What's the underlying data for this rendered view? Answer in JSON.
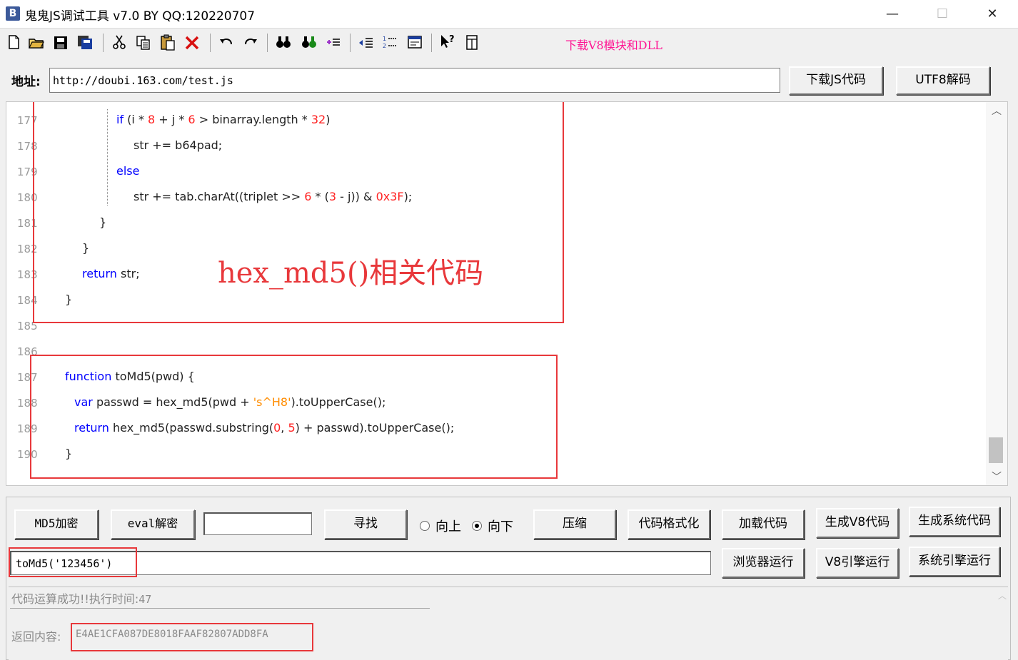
{
  "window": {
    "title": "鬼鬼JS调试工具 v7.0 BY QQ:120220707",
    "icon_letter": "B",
    "minimize": "—",
    "maximize": "☐",
    "close": "✕"
  },
  "toolbar": {
    "icons": [
      "new-file-icon",
      "open-folder-icon",
      "save-icon",
      "save-all-icon",
      "cut-icon",
      "copy-icon",
      "paste-icon",
      "delete-icon",
      "undo-icon",
      "redo-icon",
      "find-icon",
      "find-next-icon",
      "list-indent-icon",
      "toggle-comment-icon",
      "numbered-list-icon",
      "window-icon",
      "help-icon",
      "panel-icon"
    ],
    "download_v8_link": "下载V8模块和DLL"
  },
  "address": {
    "label": "地址:",
    "value": "http://doubi.163.com/test.js",
    "download_button": "下载JS代码",
    "utf8_button": "UTF8解码"
  },
  "editor": {
    "line_numbers": [
      "177",
      "178",
      "179",
      "180",
      "181",
      "182",
      "183",
      "184",
      "185",
      "186",
      "187",
      "188",
      "189",
      "190"
    ],
    "annotation": "hex_md5()相关代码"
  },
  "buttons": {
    "md5": "MD5加密",
    "eval_decrypt": "eval解密",
    "find": "寻找",
    "radio_up": "向上",
    "radio_down": "向下",
    "compress": "压缩",
    "format": "代码格式化",
    "load_code": "加载代码",
    "gen_v8": "生成V8代码",
    "gen_system": "生成系统代码",
    "browser_run": "浏览器运行",
    "v8_run": "V8引擎运行",
    "system_run": "系统引擎运行"
  },
  "search": {
    "value": "",
    "direction": "down"
  },
  "expression": {
    "value": "toMd5('123456')"
  },
  "result": {
    "status_text": "代码运算成功!!执行时间:",
    "exec_time": "47",
    "return_label": "返回内容:",
    "return_value": "E4AE1CFA087DE8018FAAF82807ADD8FA"
  },
  "colors": {
    "keyword": "#0000ff",
    "number": "#ff2020",
    "string": "#ff8c00",
    "annotation_red": "#e8383b",
    "download_link": "#ff1493"
  }
}
